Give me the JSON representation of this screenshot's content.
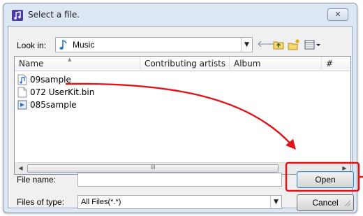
{
  "dialog": {
    "title": "Select a file.",
    "close_label": "✕"
  },
  "toolbar": {
    "lookin_label": "Look in:",
    "lookin_value": "Music",
    "icons": [
      "music-folder-icon",
      "back-arrow-icon",
      "up-folder-icon",
      "new-folder-icon",
      "view-menu-icon"
    ]
  },
  "filelist": {
    "columns": [
      "Name",
      "Contributing artists",
      "Album",
      "#"
    ],
    "files": [
      {
        "name": "09sample",
        "icon": "audio-file-icon"
      },
      {
        "name": "072 UserKit.bin",
        "icon": "blank-file-icon"
      },
      {
        "name": "085sample",
        "icon": "media-file-icon"
      }
    ],
    "scroll_thumb_label": "III"
  },
  "form": {
    "filename_label": "File name:",
    "filename_value": "",
    "filetype_label": "Files of type:",
    "filetype_value": "All Files(*.*)"
  },
  "buttons": {
    "open": "Open",
    "cancel": "Cancel"
  },
  "annotation": {
    "arrow_color": "#e0141b",
    "highlight_color": "#e0141b"
  }
}
